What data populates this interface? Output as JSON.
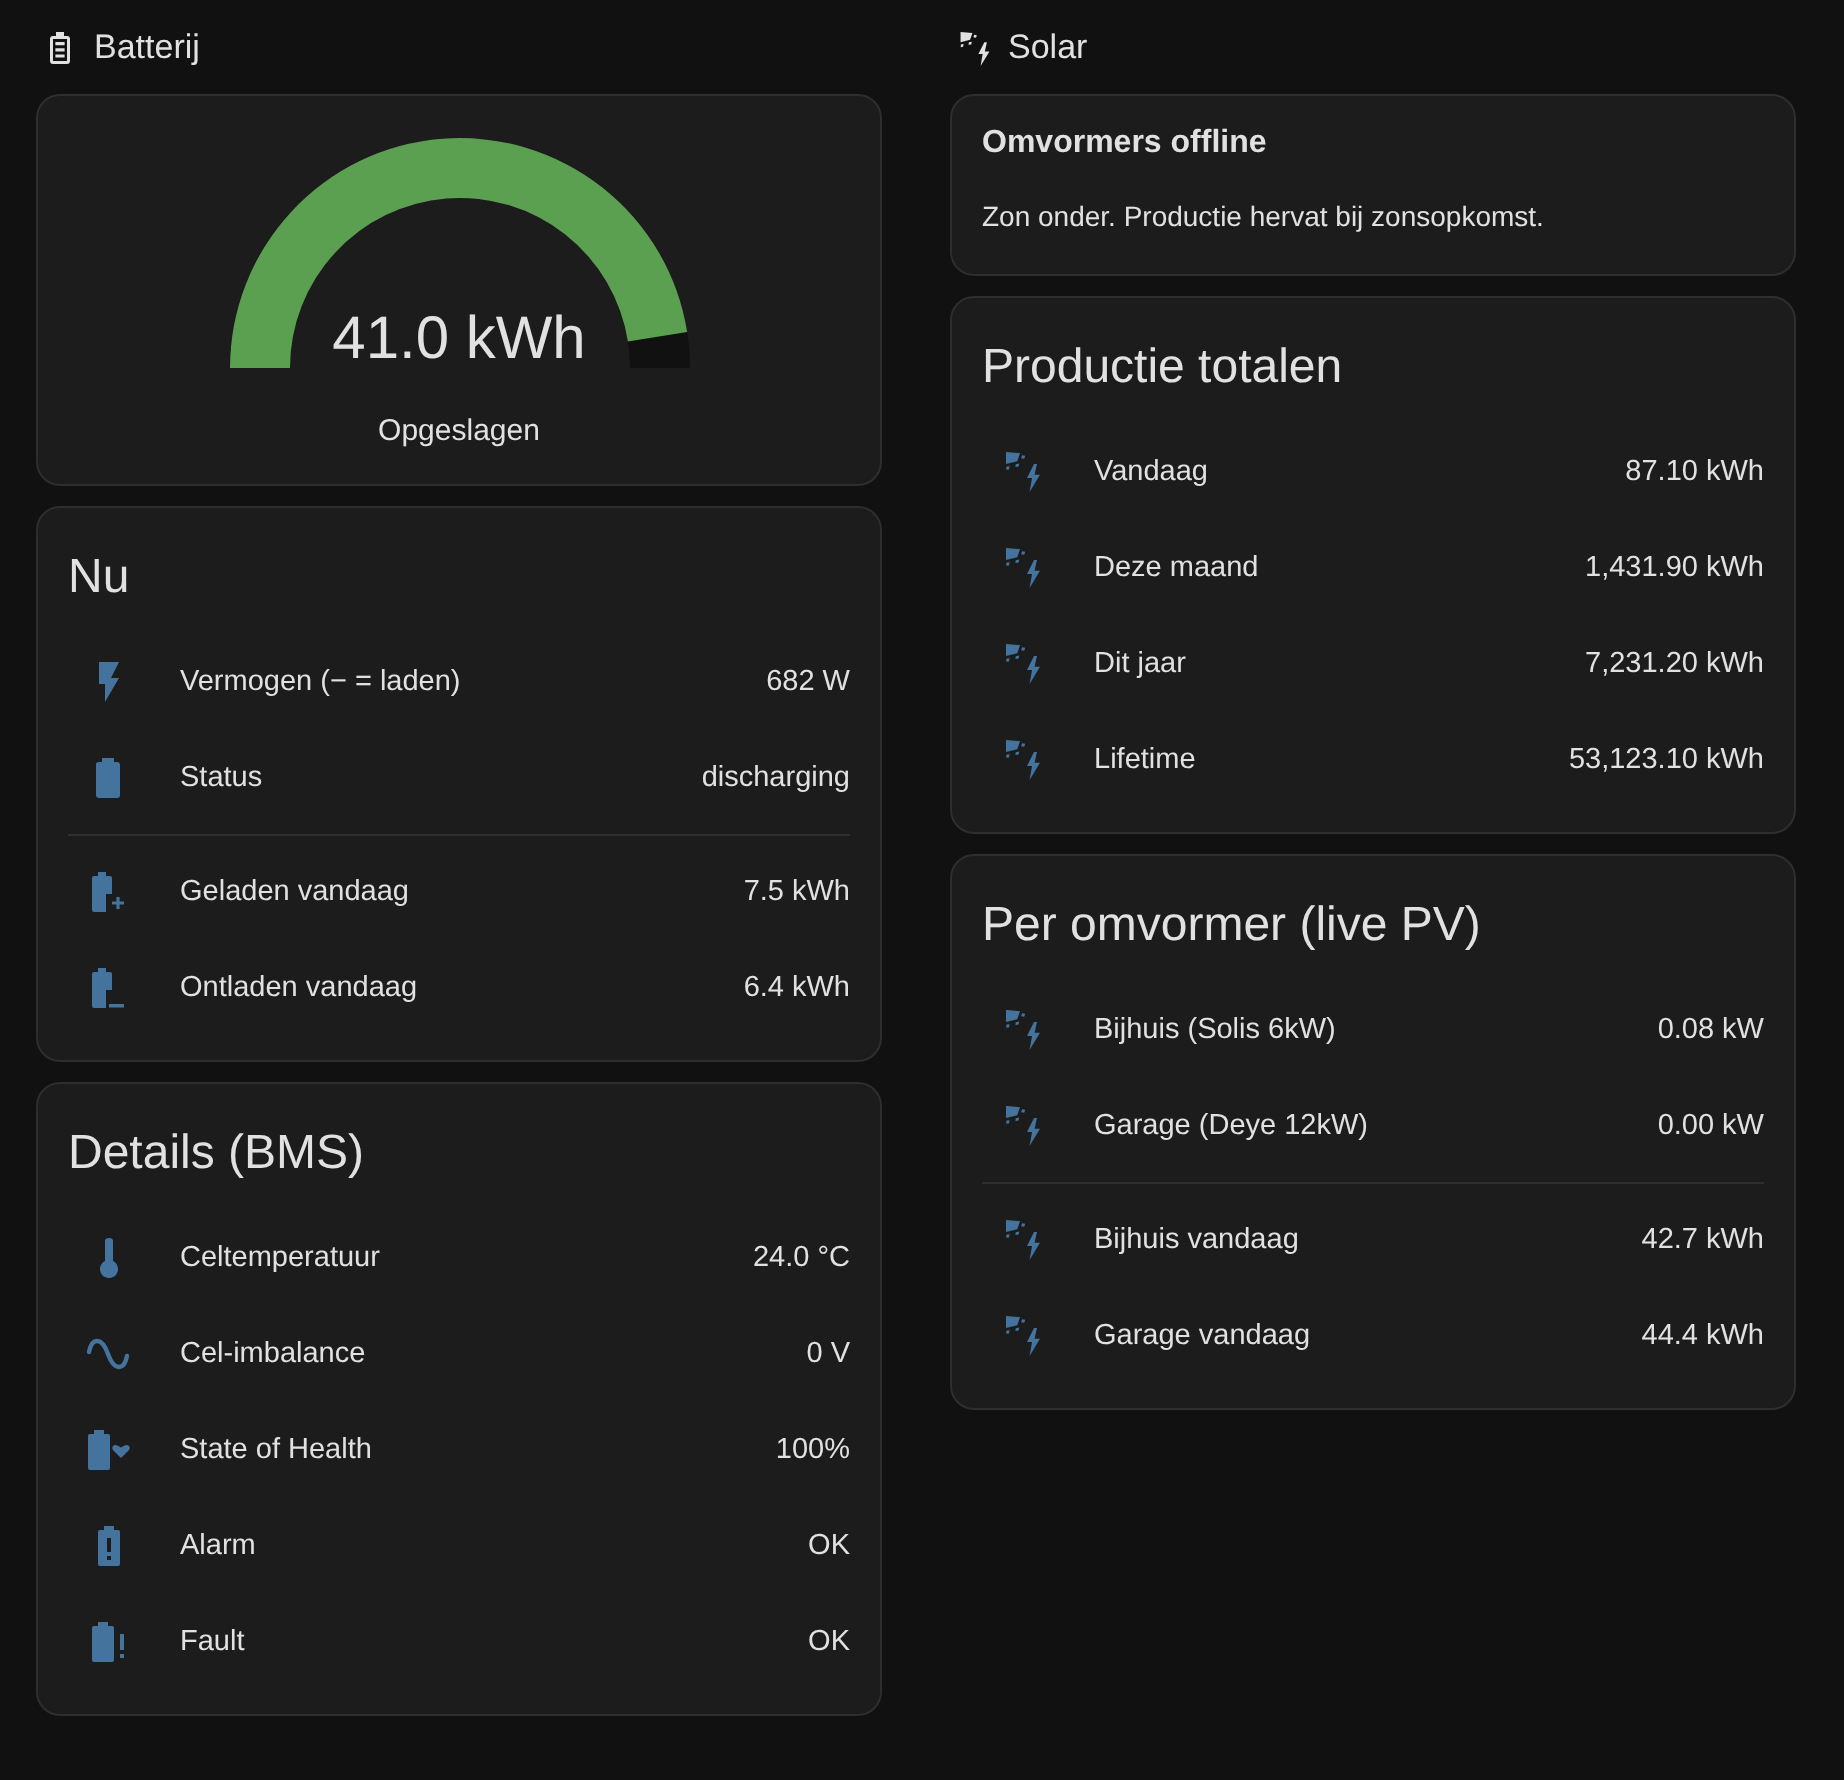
{
  "sections": [
    {
      "title": "Batterij",
      "cards": [
        {
          "kind": "gauge",
          "value": "41.0 kWh",
          "name": "Opgeslagen",
          "level": 0.95
        },
        {
          "kind": "entities",
          "title": "Nu",
          "groups": [
            [
              {
                "label": "Vermogen (− = laden)",
                "value": "682 W"
              },
              {
                "label": "Status",
                "value": "discharging"
              }
            ],
            [
              {
                "label": "Geladen vandaag",
                "value": "7.5 kWh"
              },
              {
                "label": "Ontladen vandaag",
                "value": "6.4 kWh"
              }
            ]
          ]
        },
        {
          "kind": "entities",
          "title": "Details (BMS)",
          "groups": [
            [
              {
                "label": "Celtemperatuur",
                "value": "24.0 °C"
              },
              {
                "label": "Cel-imbalance",
                "value": "0 V"
              },
              {
                "label": "State of Health",
                "value": "100%"
              },
              {
                "label": "Alarm",
                "value": "OK"
              },
              {
                "label": "Fault",
                "value": "OK"
              }
            ]
          ]
        }
      ]
    },
    {
      "title": "Solar",
      "cards": [
        {
          "kind": "markdown",
          "heading": "Omvormers offline",
          "text": "Zon onder. Productie hervat bij zonsopkomst."
        },
        {
          "kind": "entities",
          "title": "Productie totalen",
          "groups": [
            [
              {
                "label": "Vandaag",
                "value": "87.10 kWh"
              },
              {
                "label": "Deze maand",
                "value": "1,431.90 kWh"
              },
              {
                "label": "Dit jaar",
                "value": "7,231.20 kWh"
              },
              {
                "label": "Lifetime",
                "value": "53,123.10 kWh"
              }
            ]
          ]
        },
        {
          "kind": "entities",
          "title": "Per omvormer (live PV)",
          "groups": [
            [
              {
                "label": "Bijhuis (Solis 6kW)",
                "value": "0.08 kW"
              },
              {
                "label": "Garage (Deye 12kW)",
                "value": "0.00 kW"
              }
            ],
            [
              {
                "label": "Bijhuis vandaag",
                "value": "42.7 kWh"
              },
              {
                "label": "Garage vandaag",
                "value": "44.4 kWh"
              }
            ]
          ]
        }
      ]
    }
  ]
}
